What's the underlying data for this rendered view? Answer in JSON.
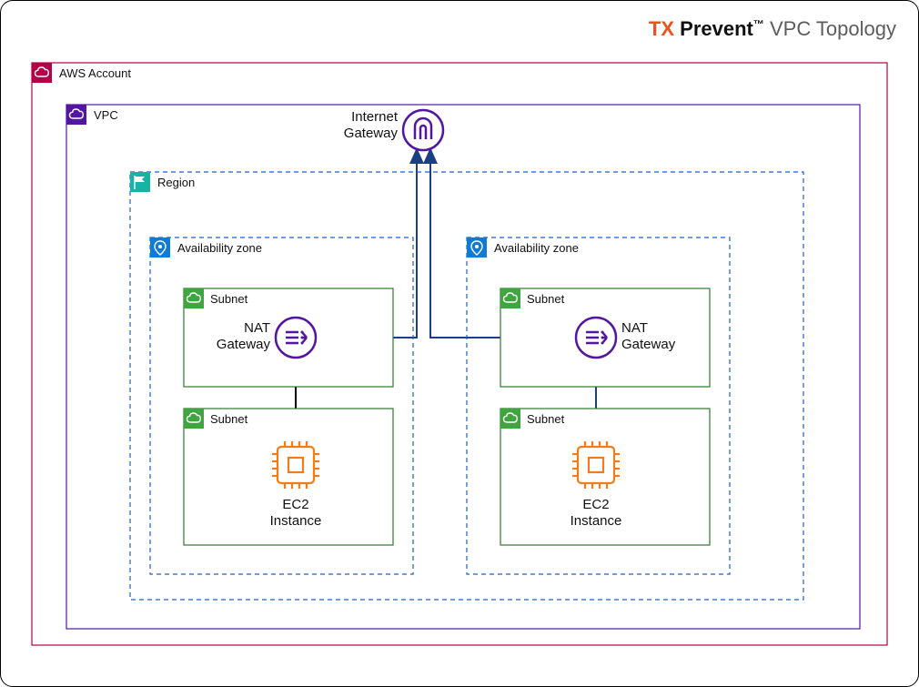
{
  "title": {
    "tx": "TX",
    "prevent": "Prevent",
    "tm": "™",
    "tail": " VPC Topology"
  },
  "icons": {
    "aws": "cloud-icon",
    "vpc": "cloud-icon",
    "region": "flag-icon",
    "az": "pin-icon",
    "subnet": "cloud-icon",
    "internet_gateway": "gateway-icon",
    "nat_gateway": "nat-icon",
    "ec2": "chip-icon"
  },
  "labels": {
    "aws_account": "AWS Account",
    "vpc": "VPC",
    "region": "Region",
    "az": "Availability zone",
    "subnet": "Subnet",
    "internet_gateway_l1": "Internet",
    "internet_gateway_l2": "Gateway",
    "nat_l1": "NAT",
    "nat_l2": "Gateway",
    "ec2_l1": "EC2",
    "ec2_l2": "Instance"
  },
  "colors": {
    "aws_border": "#b30046",
    "vpc_border": "#5316a0",
    "region_border": "#1f5fbf",
    "az_border": "#1f5fbf",
    "subnet_border": "#2e7a2e",
    "badge_region": "#16b5a3",
    "badge_az": "#0f7bd6",
    "badge_subnet": "#3fa63f",
    "ec2": "#f07d1a",
    "connector": "#1b3f86"
  },
  "topology": {
    "aws_account": {
      "vpc": {
        "internet_gateway": "Internet Gateway",
        "region": {
          "availability_zones": [
            {
              "subnets": [
                {
                  "kind": "public",
                  "node": "NAT Gateway"
                },
                {
                  "kind": "private",
                  "node": "EC2 Instance"
                }
              ]
            },
            {
              "subnets": [
                {
                  "kind": "public",
                  "node": "NAT Gateway"
                },
                {
                  "kind": "private",
                  "node": "EC2 Instance"
                }
              ]
            }
          ]
        }
      }
    },
    "connections": [
      {
        "from": "az1.ec2",
        "to": "az1.nat"
      },
      {
        "from": "az2.ec2",
        "to": "az2.nat"
      },
      {
        "from": "az1.nat",
        "to": "internet_gateway"
      },
      {
        "from": "az2.nat",
        "to": "internet_gateway"
      }
    ]
  }
}
